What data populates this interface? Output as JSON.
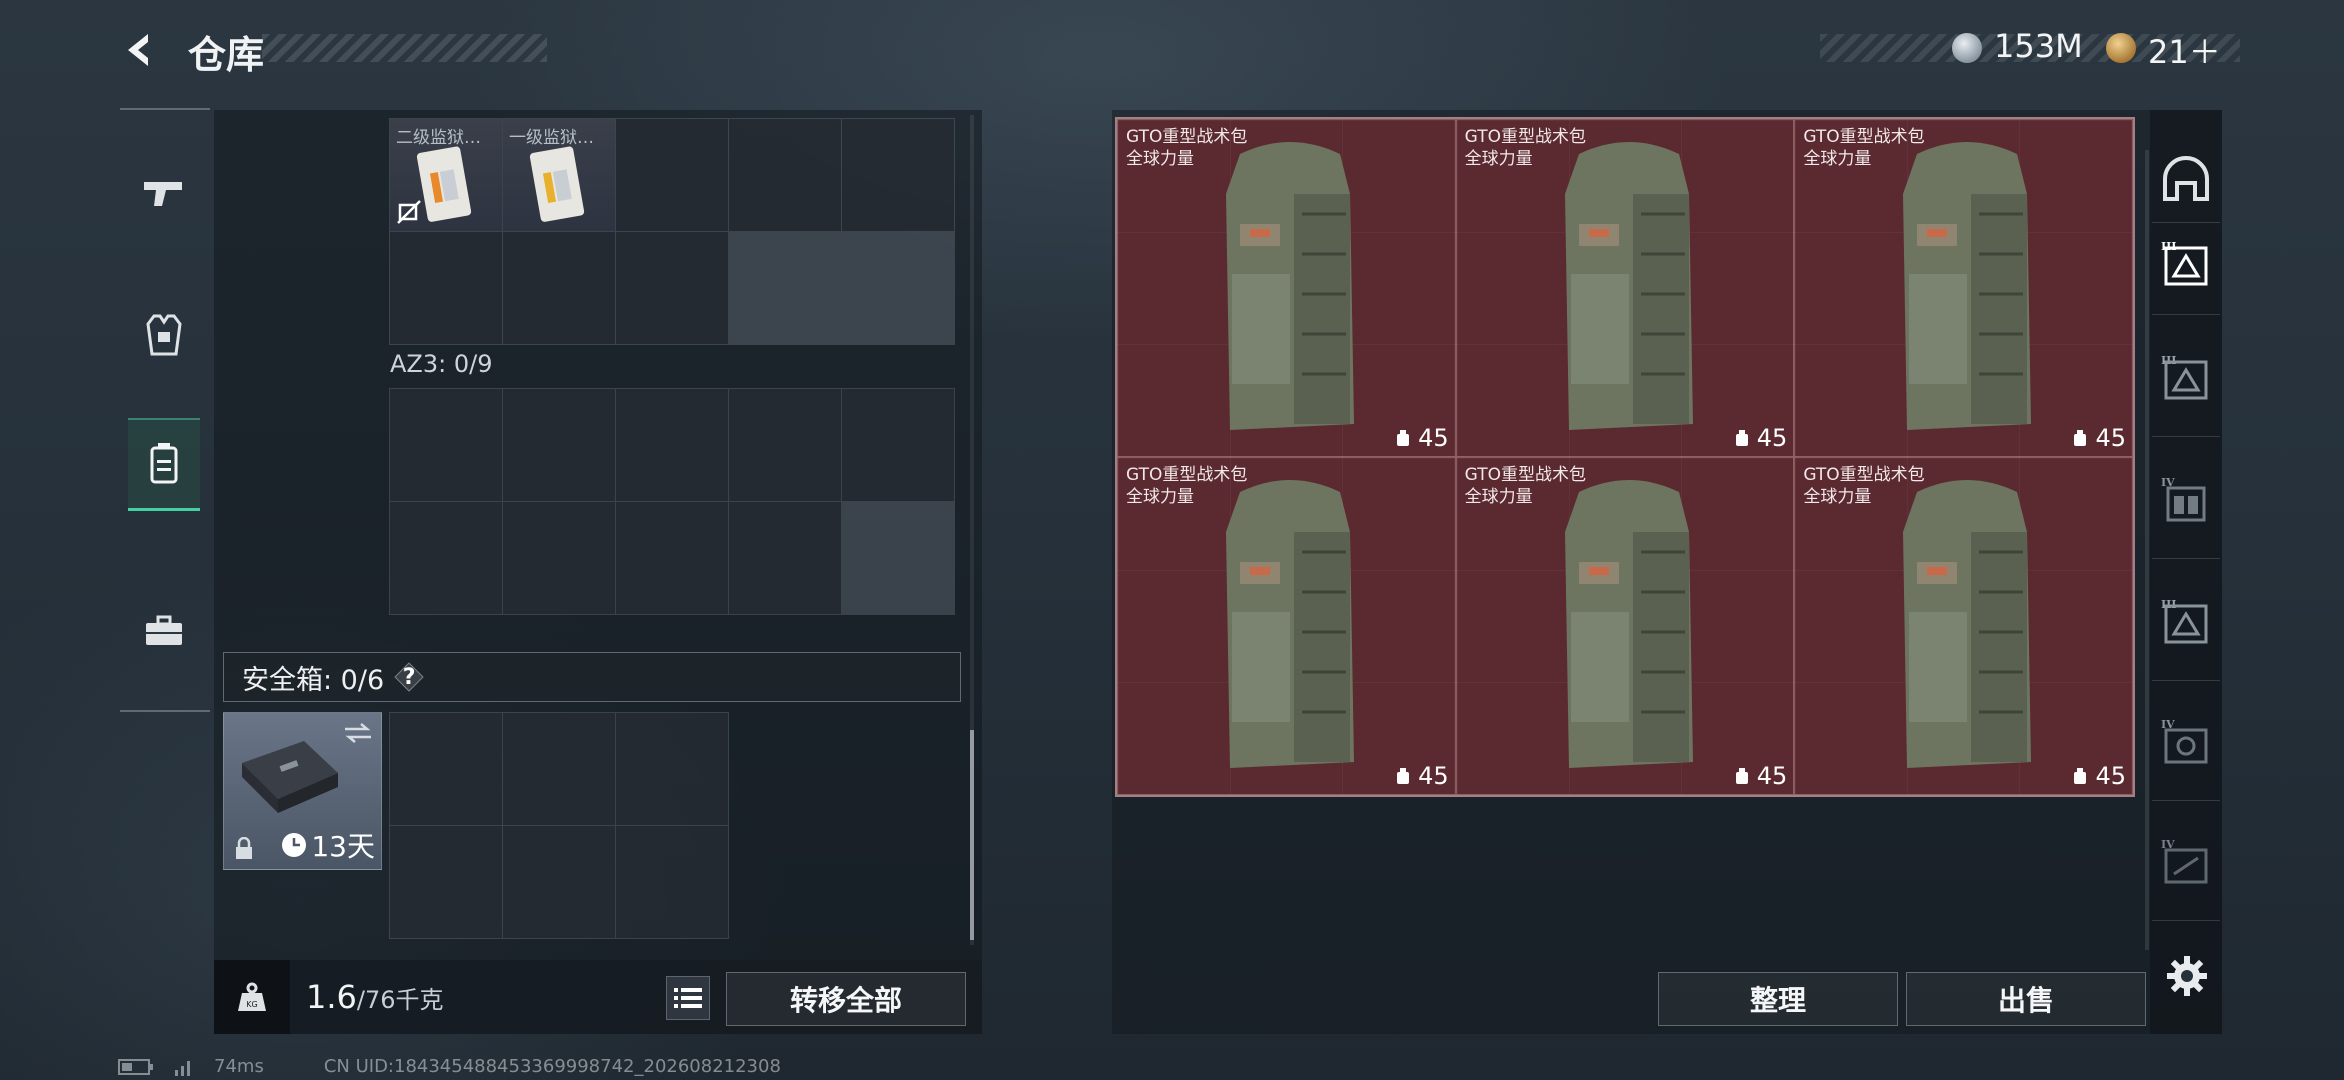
{
  "header": {
    "title": "仓库",
    "currency": [
      {
        "icon": "silver-coin-icon",
        "value": "153M"
      },
      {
        "icon": "gold-coin-icon",
        "value": "21＋"
      }
    ]
  },
  "left_tabs": [
    {
      "name": "pistol-icon",
      "active": false
    },
    {
      "name": "armor-vest-icon",
      "active": false
    },
    {
      "name": "backpack-icon",
      "active": true
    },
    {
      "name": "briefcase-icon",
      "active": false
    }
  ],
  "left_panel": {
    "items": [
      {
        "name": "二级监狱…",
        "type": "keycard"
      },
      {
        "name": "一级监狱…",
        "type": "keycard"
      }
    ],
    "az3_label": "AZ3: 0/9",
    "safe_box_label": "安全箱: 0/6",
    "safe_box_help": "?",
    "case_days": "13天",
    "weight_value": "1.6",
    "weight_capacity": "/76千克",
    "transfer_all": "转移全部"
  },
  "right_panel": {
    "backpacks": [
      {
        "name": "GTO重型战术包",
        "brand": "全球力量",
        "count": "45"
      },
      {
        "name": "GTO重型战术包",
        "brand": "全球力量",
        "count": "45"
      },
      {
        "name": "GTO重型战术包",
        "brand": "全球力量",
        "count": "45"
      },
      {
        "name": "GTO重型战术包",
        "brand": "全球力量",
        "count": "45"
      },
      {
        "name": "GTO重型战术包",
        "brand": "全球力量",
        "count": "45"
      },
      {
        "name": "GTO重型战术包",
        "brand": "全球力量",
        "count": "45"
      }
    ],
    "organize": "整理",
    "sell": "出售"
  },
  "right_tabs": [
    {
      "name": "helmet-icon",
      "level": ""
    },
    {
      "name": "backpack-tier-icon",
      "level": "III"
    },
    {
      "name": "backpack-tier-icon",
      "level": "III"
    },
    {
      "name": "chest-rig-tier-icon",
      "level": "IV"
    },
    {
      "name": "backpack-tier-icon",
      "level": "III"
    },
    {
      "name": "backpack-tier-icon",
      "level": "IV"
    },
    {
      "name": "backpack-tier-icon",
      "level": "IV"
    }
  ],
  "status": {
    "ping": "74ms",
    "uid": "CN UID:1843454884533699987​42_202608212308"
  },
  "colors": {
    "accent_green": "#44d0a0",
    "backpack_bg": "#5b2a31"
  }
}
